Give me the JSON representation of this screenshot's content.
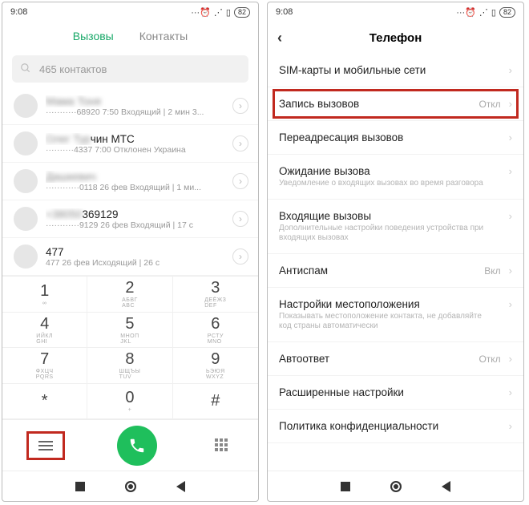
{
  "status": {
    "time": "9:08",
    "battery": "82"
  },
  "left": {
    "tabs": {
      "calls": "Вызовы",
      "contacts": "Контакты"
    },
    "search_placeholder": "465 контактов",
    "calls": [
      {
        "name_blur": "Мама Тоня",
        "name_clear": "",
        "sub_blur": "···········68920",
        "sub_clear": " 7:50 Входящий | 2 мин 3..."
      },
      {
        "name_blur": "Олег Тур",
        "name_clear": "чин МТС",
        "sub_blur": "··········4337",
        "sub_clear": " 7:00 Отклонен Украина"
      },
      {
        "name_blur": "Дашкевич",
        "name_clear": "",
        "sub_blur": "············0118",
        "sub_clear": " 26 фев Входящий | 1 ми..."
      },
      {
        "name_blur": "+38050",
        "name_clear": "369129",
        "sub_blur": "············9129",
        "sub_clear": " 26 фев Входящий | 17 с"
      },
      {
        "name_blur": "",
        "name_clear": "477",
        "sub_blur": "",
        "sub_clear": "477 26 фев Исходящий | 26 с"
      }
    ],
    "dialpad": [
      {
        "num": "1",
        "sub": "∞"
      },
      {
        "num": "2",
        "sub": "АБВГ\nABC"
      },
      {
        "num": "3",
        "sub": "ДЕЁЖЗ\nDEF"
      },
      {
        "num": "4",
        "sub": "ИЙКЛ\nGHI"
      },
      {
        "num": "5",
        "sub": "МНОП\nJKL"
      },
      {
        "num": "6",
        "sub": "РСТУ\nMNO"
      },
      {
        "num": "7",
        "sub": "ФХЦЧ\nPQRS"
      },
      {
        "num": "8",
        "sub": "ШЩЪЫ\nTUV"
      },
      {
        "num": "9",
        "sub": "ЬЭЮЯ\nWXYZ"
      },
      {
        "num": "*",
        "sub": ""
      },
      {
        "num": "0",
        "sub": "+"
      },
      {
        "num": "#",
        "sub": ""
      }
    ]
  },
  "right": {
    "title": "Телефон",
    "rows": [
      {
        "label": "SIM-карты и мобильные сети",
        "val": "",
        "desc": "",
        "hl": false
      },
      {
        "label": "Запись вызовов",
        "val": "Откл",
        "desc": "",
        "hl": true
      },
      {
        "label": "Переадресация вызовов",
        "val": "",
        "desc": "",
        "hl": false
      },
      {
        "label": "Ожидание вызова",
        "val": "",
        "desc": "Уведомление о входящих вызовах во время разговора",
        "hl": false
      },
      {
        "label": "Входящие вызовы",
        "val": "",
        "desc": "Дополнительные настройки поведения устройства при входящих вызовах",
        "hl": false
      },
      {
        "label": "Антиспам",
        "val": "Вкл",
        "desc": "",
        "hl": false
      },
      {
        "label": "Настройки местоположения",
        "val": "",
        "desc": "Показывать местоположение контакта, не добавляйте код страны автоматически",
        "hl": false
      },
      {
        "label": "Автоответ",
        "val": "Откл",
        "desc": "",
        "hl": false
      },
      {
        "label": "Расширенные настройки",
        "val": "",
        "desc": "",
        "hl": false
      },
      {
        "label": "Политика конфиденциальности",
        "val": "",
        "desc": "",
        "hl": false
      }
    ]
  }
}
